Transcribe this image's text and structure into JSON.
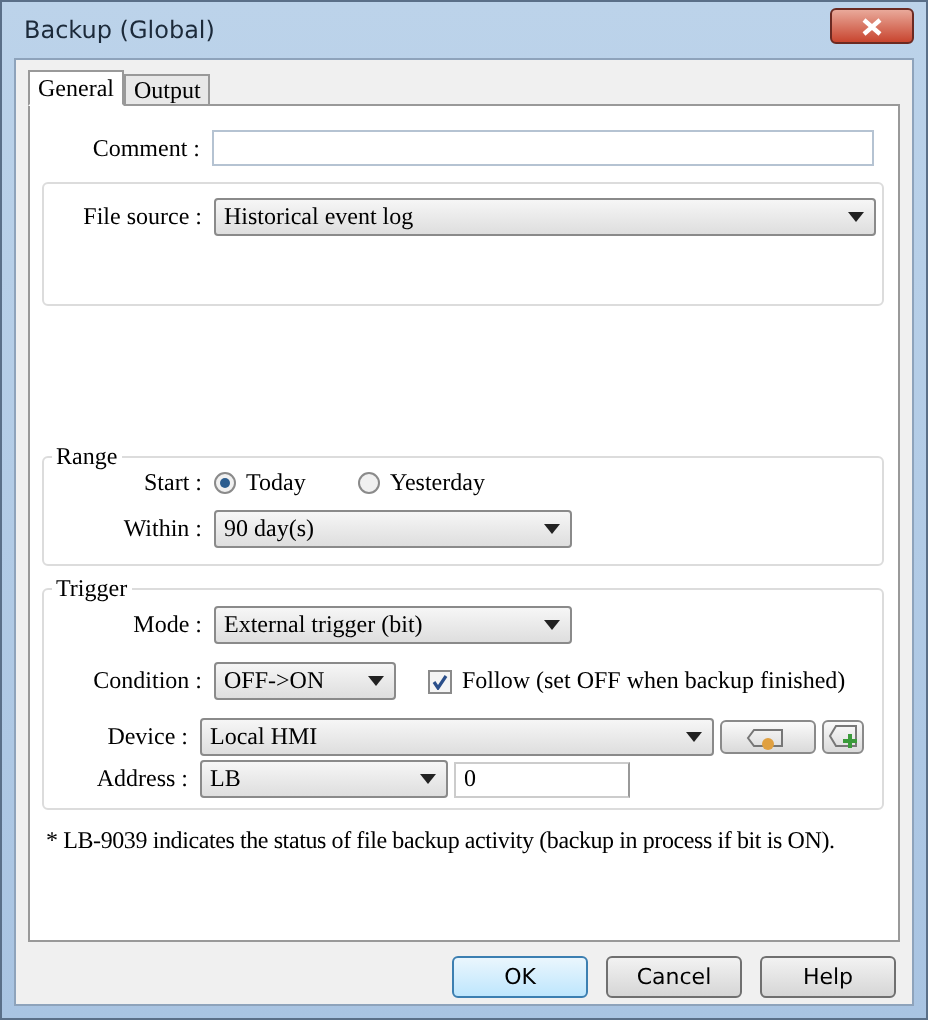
{
  "window": {
    "title": "Backup (Global)"
  },
  "tabs": [
    {
      "label": "General",
      "selected": true
    },
    {
      "label": "Output",
      "selected": false
    }
  ],
  "comment": {
    "label": "Comment :"
  },
  "file_source": {
    "label": "File source :",
    "value": "Historical event log"
  },
  "range": {
    "title": "Range",
    "start_label": "Start :",
    "start_options": [
      {
        "label": "Today",
        "selected": true
      },
      {
        "label": "Yesterday",
        "selected": false
      }
    ],
    "within_label": "Within :",
    "within_value": "90 day(s)"
  },
  "trigger": {
    "title": "Trigger",
    "mode_label": "Mode :",
    "mode_value": "External trigger (bit)",
    "condition_label": "Condition :",
    "condition_value": "OFF->ON",
    "follow": {
      "label": "Follow (set OFF when backup finished)",
      "checked": true
    },
    "device_label": "Device :",
    "device_value": "Local HMI",
    "address_label": "Address :",
    "address_type": "LB",
    "address_value": "0"
  },
  "note": "* LB-9039 indicates the status of file backup activity (backup in process if bit is ON).",
  "buttons": [
    {
      "label": "OK",
      "default": true
    },
    {
      "label": "Cancel",
      "default": false
    },
    {
      "label": "Help",
      "default": false
    }
  ]
}
